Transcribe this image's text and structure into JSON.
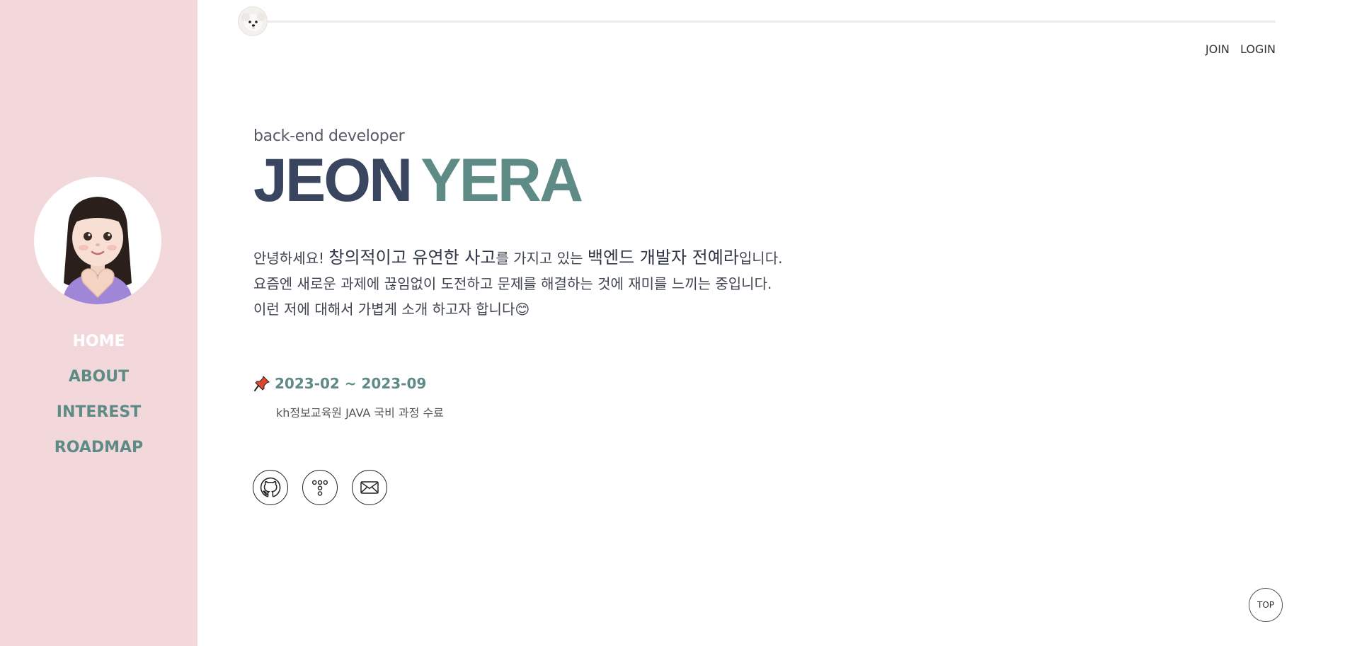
{
  "header": {
    "join_label": "JOIN",
    "login_label": "LOGIN"
  },
  "sidebar": {
    "nav": [
      {
        "label": "HOME",
        "active": true
      },
      {
        "label": "ABOUT",
        "active": false
      },
      {
        "label": "INTEREST",
        "active": false
      },
      {
        "label": "ROADMAP",
        "active": false
      }
    ]
  },
  "hero": {
    "role": "back-end developer",
    "name_first": "JEON",
    "name_last": "YERA"
  },
  "intro": {
    "line1_a": "안녕하세요! ",
    "line1_b": "창의적이고 유연한 사고",
    "line1_c": "를 가지고 있는 ",
    "line1_d": "백엔드 개발자 전예라",
    "line1_e": "입니다.",
    "line2": "요즘엔 새로운 과제에 끊임없이 도전하고 문제를 해결하는 것에 재미를 느끼는 중입니다.",
    "line3": "이런 저에 대해서 가볍게 소개 하고자 합니다😊"
  },
  "history": {
    "period": "2023-02 ~ 2023-09",
    "detail": "kh정보교육원 JAVA 국비 과정 수료"
  },
  "socials": [
    {
      "icon": "github-icon"
    },
    {
      "icon": "tistory-icon"
    },
    {
      "icon": "mail-icon"
    }
  ],
  "top_button": "TOP",
  "colors": {
    "sidebar_bg": "#f2d8da",
    "accent": "#5e8b86",
    "name_dark": "#3a4660"
  }
}
